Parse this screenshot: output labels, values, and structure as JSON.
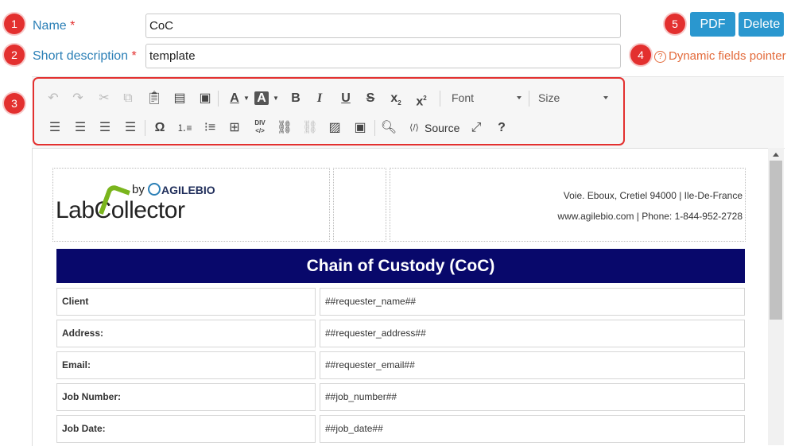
{
  "form": {
    "name_label": "Name",
    "name_value": "CoC",
    "short_desc_label": "Short description",
    "short_desc_value": "template",
    "required_mark": "*",
    "pdf_label": "PDF",
    "delete_label": "Delete",
    "pointer_label": "Dynamic fields pointer",
    "pointer_icon_glyph": "?"
  },
  "badges": [
    "1",
    "2",
    "3",
    "4",
    "5"
  ],
  "toolbar": {
    "font_label": "Font",
    "size_label": "Size",
    "source_label": "Source",
    "row1_icons": [
      "undo-icon",
      "redo-icon",
      "cut-icon",
      "copy-icon",
      "paste-icon",
      "paste-text-icon",
      "paste-word-icon",
      "text-color-icon",
      "bg-color-icon",
      "bold-icon",
      "italic-icon",
      "underline-icon",
      "strike-icon",
      "subscript-icon",
      "superscript-icon"
    ],
    "row2_icons": [
      "align-left-icon",
      "align-center-icon",
      "align-right-icon",
      "justify-icon",
      "special-char-icon",
      "numbered-list-icon",
      "bulleted-list-icon",
      "table-icon",
      "div-icon",
      "link-icon",
      "unlink-icon",
      "image-icon",
      "insert-image-icon",
      "preview-icon",
      "source-icon",
      "maximize-icon",
      "help-icon"
    ]
  },
  "document": {
    "logo_by": "by",
    "logo_company": "AGILEBIO",
    "logo_main": "LabCollector",
    "address_line1": "Voie. Eboux, Cretiel 94000 | Ile-De-France",
    "address_line2": "www.agilebio.com  | Phone: 1-844-952-2728",
    "title": "Chain of Custody (CoC)",
    "rows": [
      {
        "label": "Client",
        "value": "##requester_name##"
      },
      {
        "label": "Address:",
        "value": "##requester_address##"
      },
      {
        "label": "Email:",
        "value": "##requester_email##"
      },
      {
        "label": "Job Number:",
        "value": "##job_number##"
      },
      {
        "label": "Job Date:",
        "value": "##job_date##"
      }
    ]
  },
  "colors": {
    "accent": "#2a97cf",
    "badge": "#e3302f",
    "label": "#2b7fb6",
    "pointer": "#e36a3a",
    "title_bar": "#08086b",
    "logo_green": "#7ab51d"
  }
}
